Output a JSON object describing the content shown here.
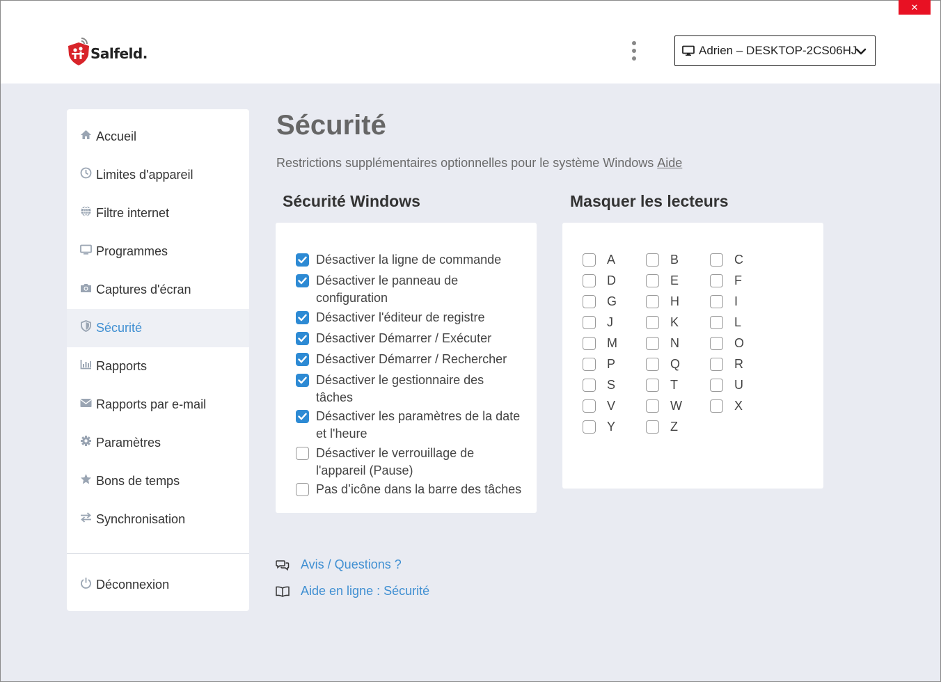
{
  "window": {
    "close_glyph": "✕"
  },
  "logo": {
    "text": "Salfeld.",
    "icon": "salfeld-shield-icon"
  },
  "header": {
    "menu_icon": "kebab-menu-icon",
    "device_selector": {
      "value": "Adrien – DESKTOP-2CS06HJ",
      "icon": "monitor-icon"
    }
  },
  "sidebar": {
    "items": [
      {
        "label": "Accueil",
        "icon": "home-icon",
        "active": false
      },
      {
        "label": "Limites d'appareil",
        "icon": "clock-icon",
        "active": false
      },
      {
        "label": "Filtre internet",
        "icon": "globe-icon",
        "active": false
      },
      {
        "label": "Programmes",
        "icon": "monitor-icon",
        "active": false
      },
      {
        "label": "Captures d'écran",
        "icon": "camera-icon",
        "active": false
      },
      {
        "label": "Sécurité",
        "icon": "shield-icon",
        "active": true
      },
      {
        "label": "Rapports",
        "icon": "bar-chart-icon",
        "active": false
      },
      {
        "label": "Rapports par e-mail",
        "icon": "envelope-icon",
        "active": false
      },
      {
        "label": "Paramètres",
        "icon": "gear-icon",
        "active": false
      },
      {
        "label": "Bons de temps",
        "icon": "star-icon",
        "active": false
      },
      {
        "label": "Synchronisation",
        "icon": "sync-arrows-icon",
        "active": false
      }
    ],
    "logout": {
      "label": "Déconnexion",
      "icon": "power-icon"
    }
  },
  "main": {
    "title": "Sécurité",
    "subtitle": "Restrictions supplémentaires optionnelles pour le système Windows",
    "help_link": "Aide",
    "windows_security": {
      "title": "Sécurité Windows",
      "options": [
        {
          "line1": "Désactiver la ligne de commande",
          "line2": "",
          "checked": true
        },
        {
          "line1": "Désactiver le panneau de",
          "line2": "configuration",
          "checked": true
        },
        {
          "line1": "Désactiver l'éditeur de registre",
          "line2": "",
          "checked": true
        },
        {
          "line1": "Désactiver Démarrer / Exécuter",
          "line2": "",
          "checked": true
        },
        {
          "line1": "Désactiver Démarrer / Rechercher",
          "line2": "",
          "checked": true
        },
        {
          "line1": "Désactiver le gestionnaire des",
          "line2": "tâches",
          "checked": true
        },
        {
          "line1": "Désactiver les paramètres de la date",
          "line2": "et l'heure",
          "checked": true
        },
        {
          "line1": "Désactiver le verrouillage de",
          "line2": "l'appareil (Pause)",
          "checked": false
        },
        {
          "line1": "Pas d’icône dans la barre des tâches",
          "line2": "",
          "checked": false
        }
      ]
    },
    "hide_drives": {
      "title": "Masquer les lecteurs",
      "drives": [
        "A",
        "B",
        "C",
        "D",
        "E",
        "F",
        "G",
        "H",
        "I",
        "J",
        "K",
        "L",
        "M",
        "N",
        "O",
        "P",
        "Q",
        "R",
        "S",
        "T",
        "U",
        "V",
        "W",
        "X",
        "Y",
        "Z"
      ],
      "checked": []
    },
    "footer_links": [
      {
        "label": "Avis / Questions ?",
        "icon": "chat-bubbles-icon"
      },
      {
        "label": "Aide en ligne : Sécurité",
        "icon": "open-book-icon"
      }
    ]
  },
  "colors": {
    "accent": "#3f8fd2",
    "checkbox": "#2d8ad4",
    "background": "#e9ebf2",
    "close": "#e81123"
  }
}
